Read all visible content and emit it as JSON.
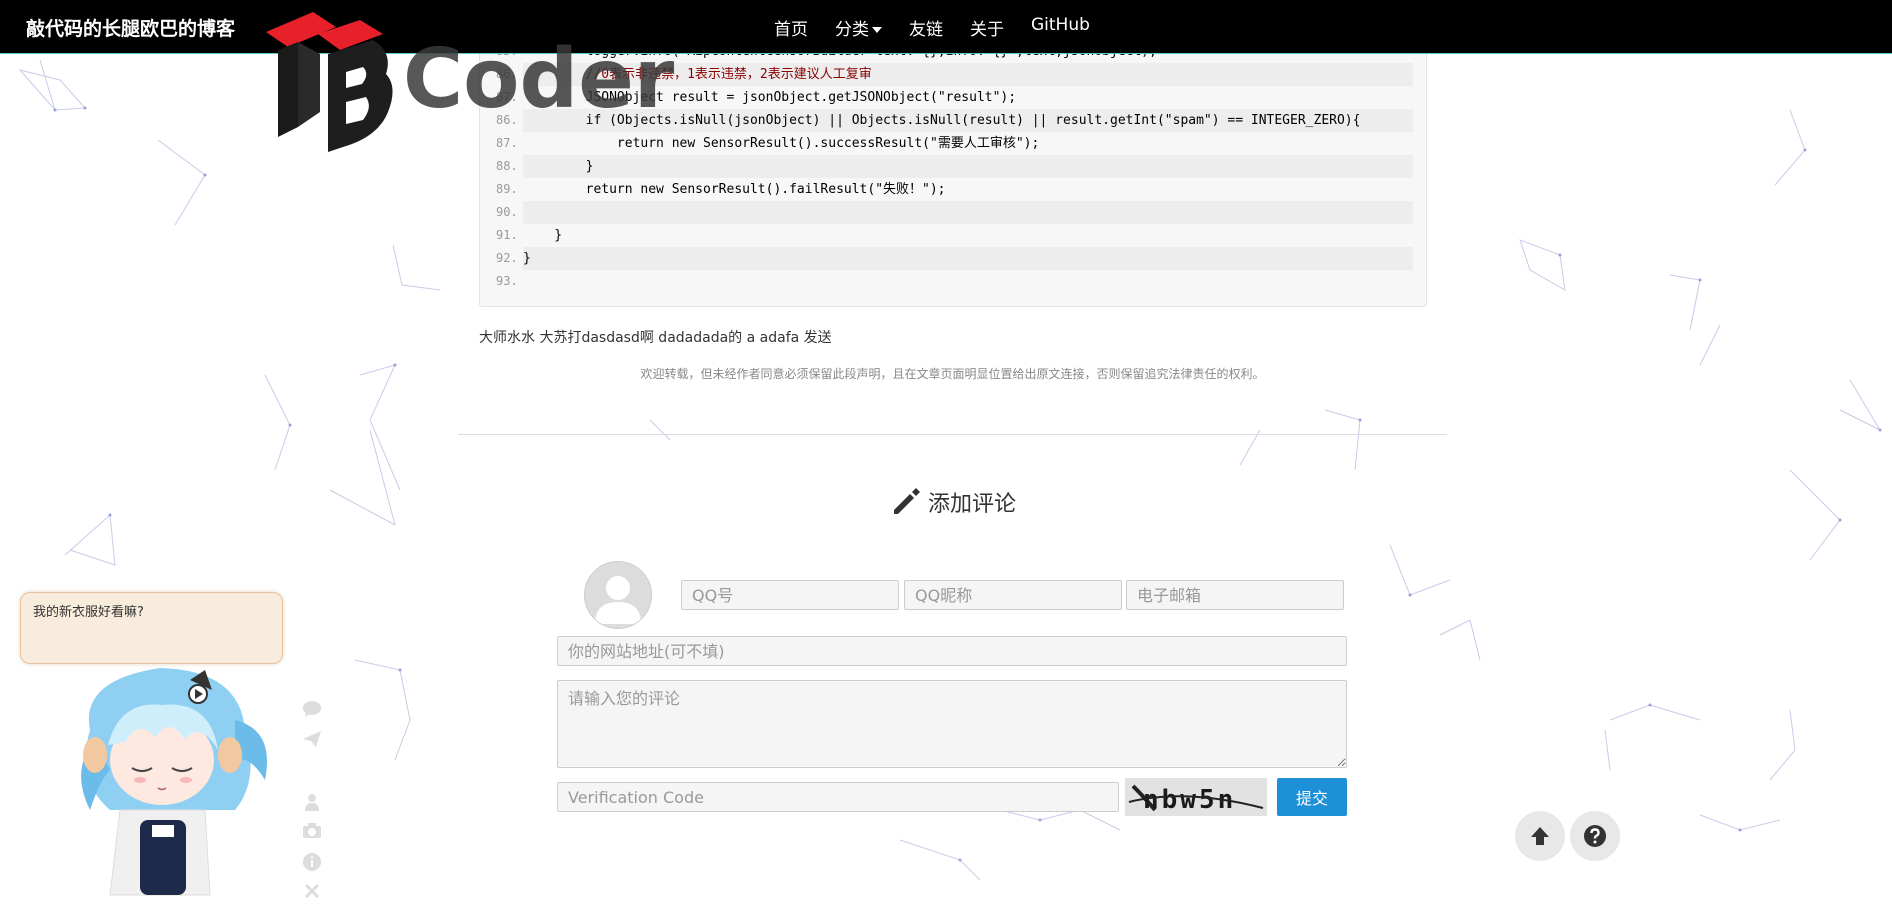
{
  "navbar": {
    "brand": "敲代码的长腿欧巴的博客",
    "items": [
      {
        "label": "首页"
      },
      {
        "label": "分类"
      },
      {
        "label": "友链"
      },
      {
        "label": "关于"
      },
      {
        "label": "GitHub"
      }
    ]
  },
  "logo": {
    "text": "Coder"
  },
  "code": {
    "lines": [
      {
        "num": "85.",
        "text": "        logger.info(\"AipContentCensorBuilder text: {},info: {}\",text,jsonObject);"
      },
      {
        "num": "86.",
        "text": "        //0表示非违禁，1表示违禁，2表示建议人工复审"
      },
      {
        "num": "87.",
        "text": "        JSONObject result = jsonObject.getJSONObject(\"result\");"
      },
      {
        "num": "86.",
        "text": "        if (Objects.isNull(jsonObject) || Objects.isNull(result) || result.getInt(\"spam\") == INTEGER_ZERO){"
      },
      {
        "num": "87.",
        "text": "            return new SensorResult().successResult(\"需要人工审核\");"
      },
      {
        "num": "88.",
        "text": "        }"
      },
      {
        "num": "89.",
        "text": "        return new SensorResult().failResult(\"失败！\");"
      },
      {
        "num": "90.",
        "text": ""
      },
      {
        "num": "91.",
        "text": "    }"
      },
      {
        "num": "92.",
        "text": "}"
      },
      {
        "num": "93.",
        "text": ""
      }
    ]
  },
  "post": {
    "text": "大师水水 大苏打dasdasd啊 dadadada的 a adafa 发送",
    "copyright": "欢迎转载，但未经作者同意必须保留此段声明，且在文章页面明显位置给出原文连接，否则保留追究法律责任的权利。"
  },
  "comment": {
    "title": "添加评论",
    "qq_placeholder": "QQ号",
    "nickname_placeholder": "QQ昵称",
    "email_placeholder": "电子邮箱",
    "website_placeholder": "你的网站地址(可不填)",
    "content_placeholder": "请输入您的评论",
    "verify_placeholder": "Verification Code",
    "captcha_text": "nbw5n",
    "submit_label": "提交"
  },
  "widget": {
    "bubble_text": "我的新衣服好看嘛?"
  },
  "colors": {
    "navbar_bg": "#000000",
    "submit_bg": "#1e90d8",
    "bubble_bg": "#f8ecdd"
  }
}
